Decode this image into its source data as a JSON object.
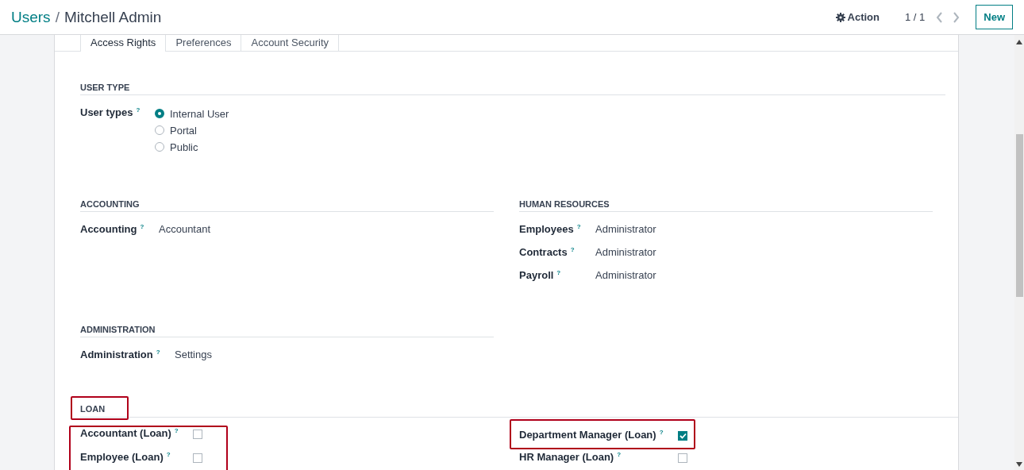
{
  "breadcrumb": [
    {
      "label": "Users",
      "kind": "link"
    },
    {
      "label": "Mitchell Admin",
      "kind": "current"
    }
  ],
  "separator": "/",
  "action": {
    "label": "Action"
  },
  "pager": "1 / 1",
  "new_button": {
    "label": "New"
  },
  "tabs": [
    {
      "label": "Access Rights",
      "selected": true
    },
    {
      "label": "Preferences",
      "selected": false
    },
    {
      "label": "Account Security",
      "selected": false
    }
  ],
  "rows": [
    {
      "sections": [
        {
          "title": "USER TYPE",
          "title_highlighted": false,
          "groups": [
            {
              "highlighted": false,
              "fields": [
                {
                  "kind": "radio",
                  "label": "User types",
                  "help": "?",
                  "highlighted": false,
                  "options": [
                    {
                      "label": "Internal User",
                      "selected": true
                    },
                    {
                      "label": "Portal",
                      "selected": false
                    },
                    {
                      "label": "Public",
                      "selected": false
                    }
                  ]
                }
              ]
            }
          ]
        }
      ]
    },
    {
      "sections": [
        {
          "title": "ACCOUNTING",
          "title_highlighted": false,
          "groups": [
            {
              "highlighted": false,
              "fields": [
                {
                  "kind": "text",
                  "label": "Accounting",
                  "help": "?",
                  "highlighted": false,
                  "value": "Accountant"
                }
              ]
            }
          ]
        },
        {
          "title": "HUMAN RESOURCES",
          "title_highlighted": false,
          "groups": [
            {
              "highlighted": false,
              "fields": [
                {
                  "kind": "text",
                  "label": "Employees",
                  "help": "?",
                  "highlighted": false,
                  "value": "Administrator"
                },
                {
                  "kind": "text",
                  "label": "Contracts",
                  "help": "?",
                  "highlighted": false,
                  "value": "Administrator"
                },
                {
                  "kind": "text",
                  "label": "Payroll",
                  "help": "?",
                  "highlighted": false,
                  "value": "Administrator"
                }
              ]
            }
          ]
        }
      ]
    },
    {
      "sections": [
        {
          "title": "ADMINISTRATION",
          "title_highlighted": false,
          "groups": [
            {
              "highlighted": false,
              "fields": [
                {
                  "kind": "text",
                  "label": "Administration",
                  "help": "?",
                  "highlighted": false,
                  "value": "Settings"
                }
              ]
            }
          ]
        }
      ]
    },
    {
      "sections": [
        {
          "title": "LOAN",
          "title_highlighted": true,
          "groups": [
            {
              "highlighted": true,
              "fields": [
                {
                  "kind": "checkbox",
                  "label": "Accountant (Loan)",
                  "help": "?",
                  "highlighted": false,
                  "checked": false
                },
                {
                  "kind": "checkbox",
                  "label": "Employee (Loan)",
                  "help": "?",
                  "highlighted": false,
                  "checked": false
                }
              ]
            },
            {
              "highlighted": false,
              "fields": [
                {
                  "kind": "checkbox",
                  "label": "Department Manager (Loan)",
                  "help": "?",
                  "highlighted": true,
                  "checked": true
                },
                {
                  "kind": "checkbox",
                  "label": "HR Manager (Loan)",
                  "help": "?",
                  "highlighted": false,
                  "checked": false
                }
              ]
            }
          ]
        }
      ]
    }
  ]
}
